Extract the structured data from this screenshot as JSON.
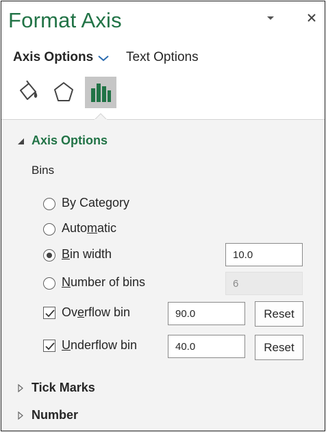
{
  "pane": {
    "title": "Format Axis"
  },
  "tabs": {
    "axis_options": "Axis Options",
    "text_options": "Text Options"
  },
  "icons": {
    "fill_line": "paint-bucket-icon",
    "effects": "pentagon-icon",
    "axis_options": "bar-chart-icon",
    "accent_color": "#217346"
  },
  "axis_options_section": {
    "heading": "Axis Options",
    "bins_label": "Bins",
    "by_category": {
      "pre": "By Category",
      "u": "",
      "post": ""
    },
    "automatic": {
      "pre": "Auto",
      "u": "m",
      "post": "atic"
    },
    "bin_width": {
      "pre": "",
      "u": "B",
      "post": "in width",
      "value": "10.0",
      "selected": true
    },
    "number_of_bins": {
      "pre": "",
      "u": "N",
      "post": "umber of bins",
      "value": "6"
    },
    "overflow_bin": {
      "pre": "Ov",
      "u": "e",
      "post": "rflow bin",
      "value": "90.0",
      "checked": true,
      "reset_label": "Reset"
    },
    "underflow_bin": {
      "pre": "",
      "u": "U",
      "post": "nderflow bin",
      "value": "40.0",
      "checked": true,
      "reset_label": "Reset"
    }
  },
  "collapsed_sections": {
    "tick_marks": "Tick Marks",
    "number": "Number"
  }
}
